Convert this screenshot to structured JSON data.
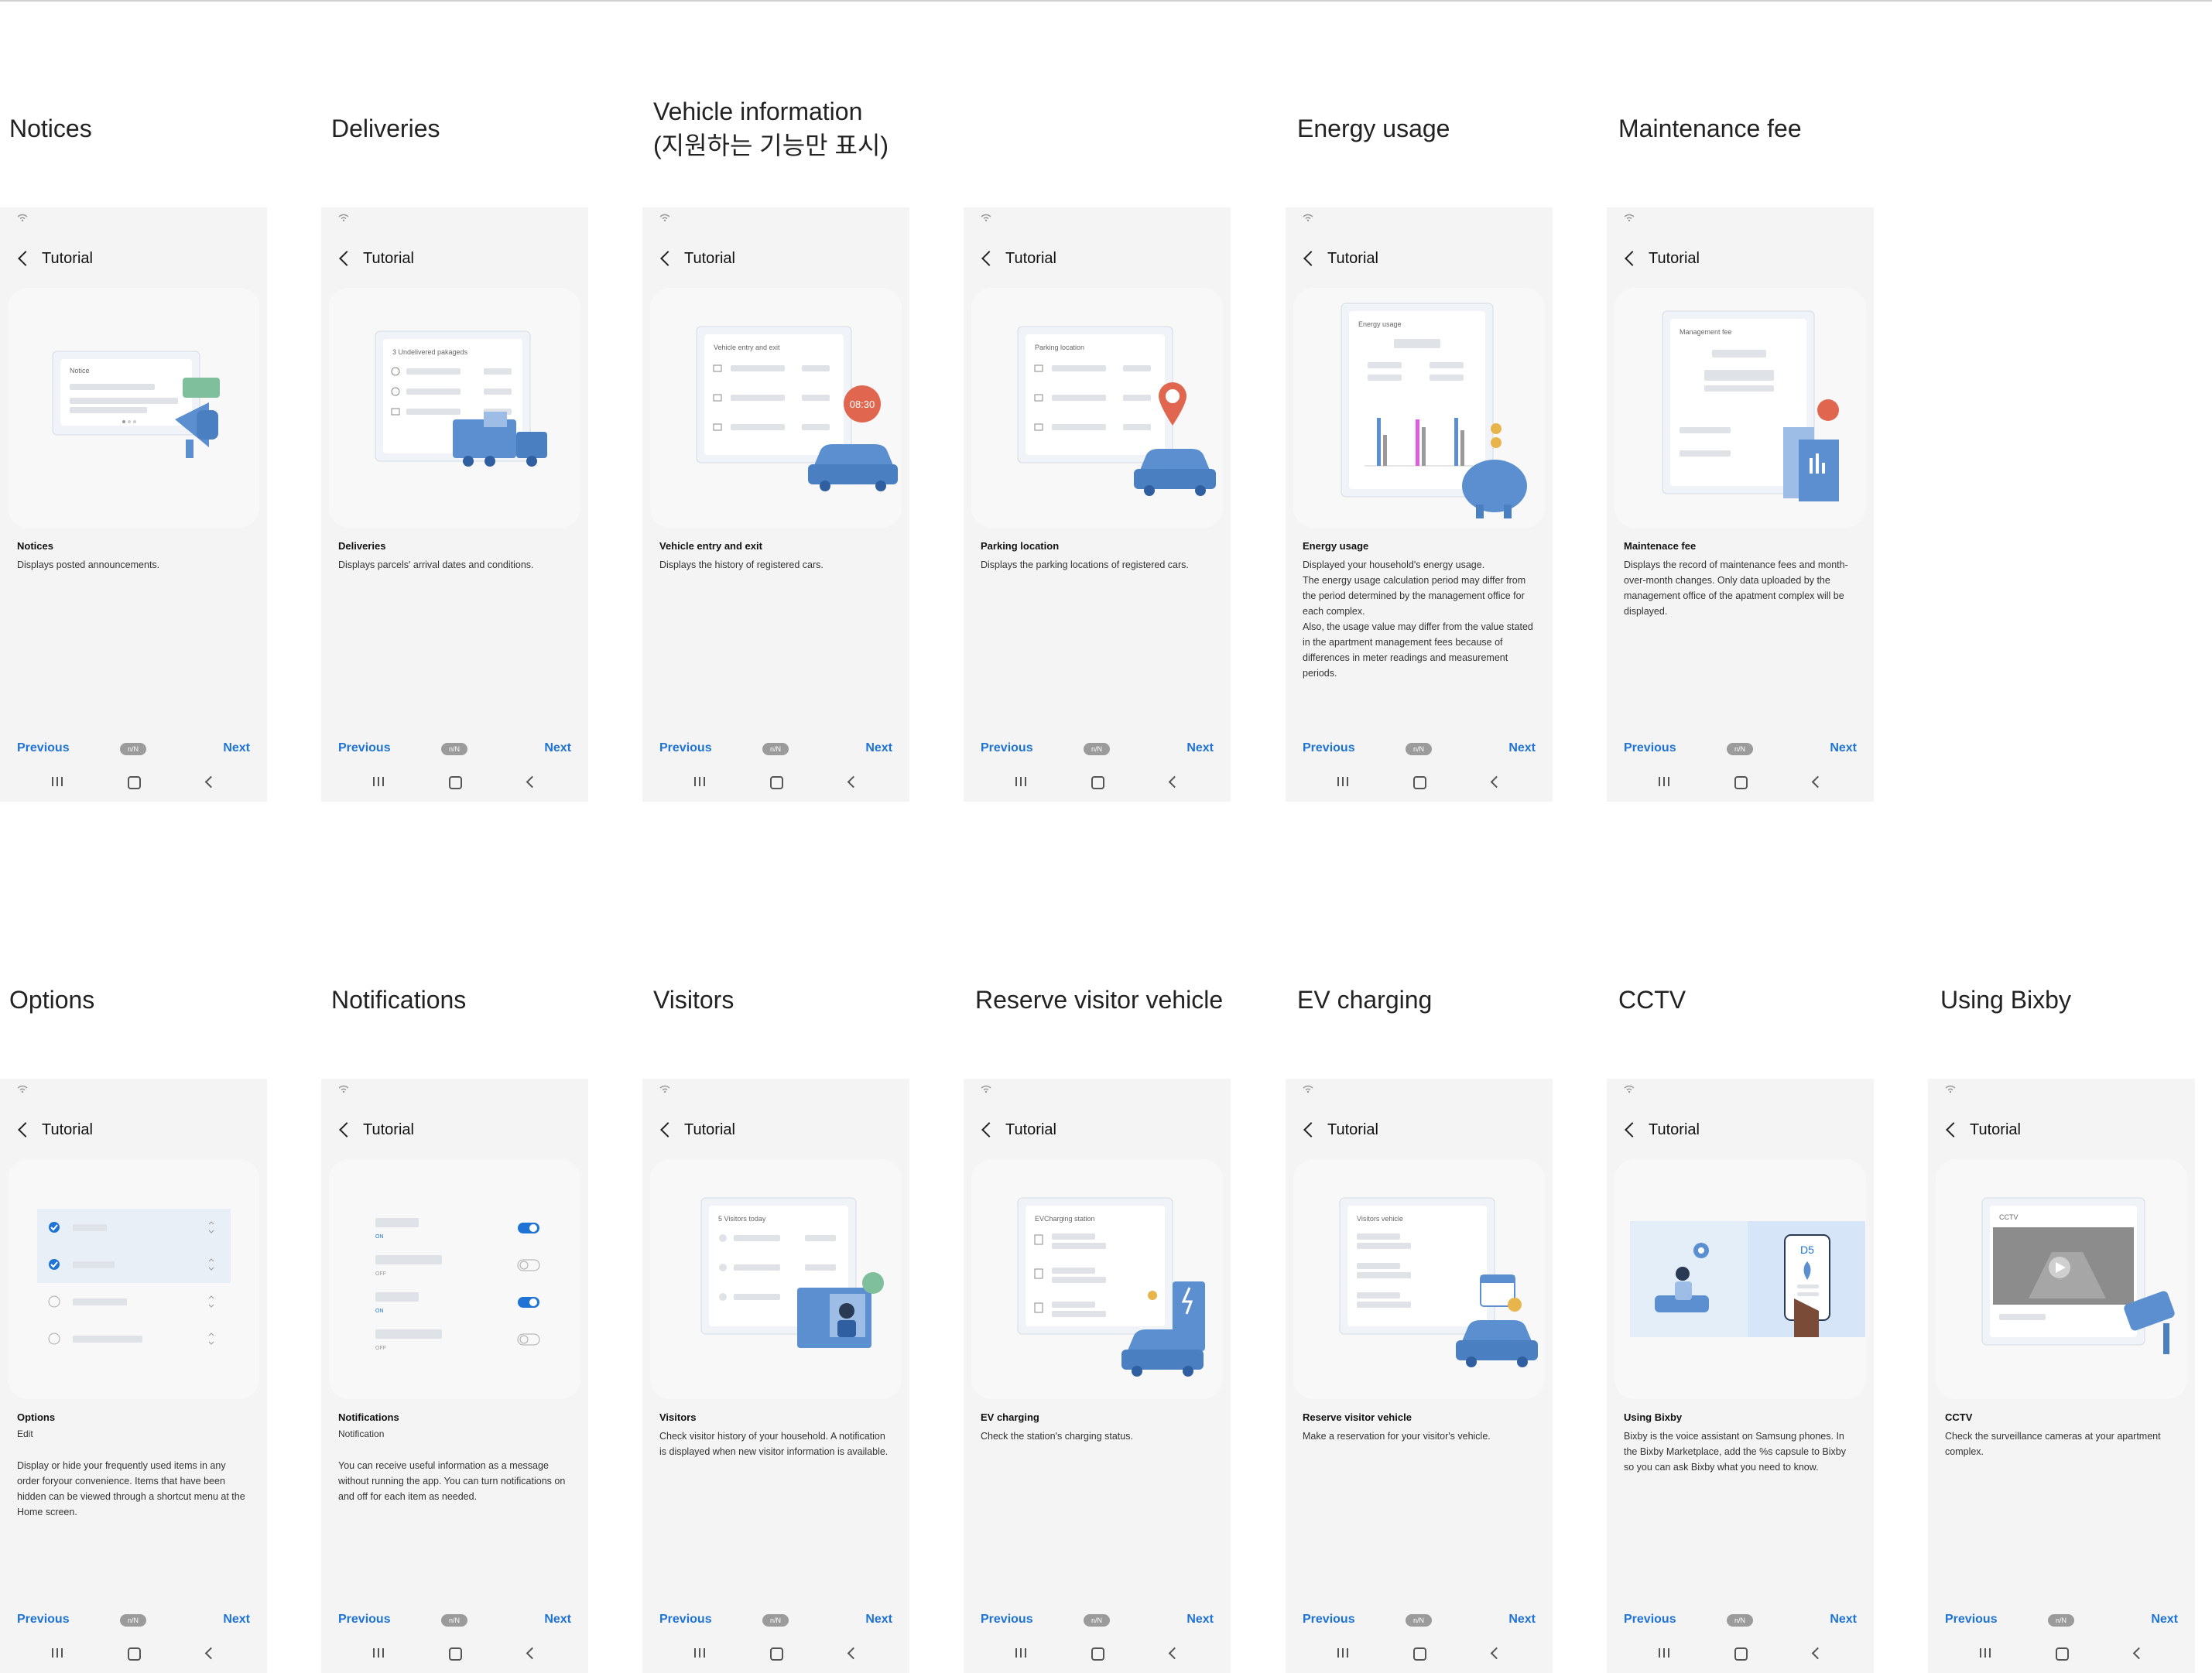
{
  "common": {
    "header_title": "Tutorial",
    "previous_label": "Previous",
    "next_label": "Next",
    "pager_label": "n/N"
  },
  "row1": [
    {
      "section_title": "Notices",
      "card_title": "Notices",
      "description": "Displays posted announcements.",
      "illus_label": "Notice"
    },
    {
      "section_title": "Deliveries",
      "card_title": "Deliveries",
      "description": "Displays parcels' arrival dates and conditions.",
      "illus_label": "3 Undelivered pakageds"
    },
    {
      "section_title": "Vehicle information\n(지원하는 기능만 표시)",
      "card_title": "Vehicle entry and exit",
      "description": "Displays the history of registered cars.",
      "illus_label": "Vehicle entry and exit",
      "badge": "08:30"
    },
    {
      "section_title": "",
      "card_title": "Parking location",
      "description": "Displays the parking locations of registered cars.",
      "illus_label": "Parking location"
    },
    {
      "section_title": "Energy usage",
      "card_title": "Energy usage",
      "description": "Displayed your household's energy usage.\nThe energy usage calculation period may differ from the period determined by the management office for each complex.\nAlso, the usage value may differ from the value stated in the apartment management fees because of differences in meter readings and measurement periods.",
      "illus_label": "Energy usage"
    },
    {
      "section_title": "Maintenance fee",
      "card_title": "Maintenace fee",
      "description": "Displays the record of maintenance fees and month-over-month changes. Only data uploaded by the management office of the apatment complex will be displayed.",
      "illus_label": "Management fee"
    }
  ],
  "row2": [
    {
      "section_title": "Options",
      "card_title": "Options",
      "subtitle": "Edit",
      "description": "Display or hide your frequently used items in any order foryour convenience. Items that have been hidden can be viewed through a shortcut menu at the Home screen."
    },
    {
      "section_title": "Notifications",
      "card_title": "Notifications",
      "subtitle": "Notification",
      "description": "You can receive useful information as a message without running the app. You can turn notifications on and off for each item as needed.",
      "toggle_labels": [
        "ON",
        "OFF",
        "ON",
        "OFF"
      ]
    },
    {
      "section_title": "Visitors",
      "card_title": "Visitors",
      "description": "Check visitor history of your household. A notification is displayed when new visitor information is available.",
      "illus_label": "5 Visitors today"
    },
    {
      "section_title": "Reserve visitor vehicle",
      "card_title": "EV charging",
      "description": "Check the station's charging status.",
      "illus_label": "EVCharging station"
    },
    {
      "section_title": "EV charging",
      "card_title": "Reserve visitor vehicle",
      "description": "Make a reservation for your visitor's vehicle.",
      "illus_label": "Visitors  vehicle"
    },
    {
      "section_title": "CCTV",
      "card_title": "Using Bixby",
      "description": "Bixby is the voice assistant on Samsung phones. In the Bixby Marketplace, add the %s capsule to Bixby so you can ask Bixby what you need to know.",
      "badge": "D5"
    },
    {
      "section_title": "Using Bixby",
      "card_title": "CCTV",
      "description": "Check the surveillance cameras at your apartment complex.",
      "illus_label": "CCTV"
    }
  ],
  "colors": {
    "accent": "#1f73d4",
    "illus_blue": "#5b8fd0",
    "illus_red": "#e0664f"
  }
}
